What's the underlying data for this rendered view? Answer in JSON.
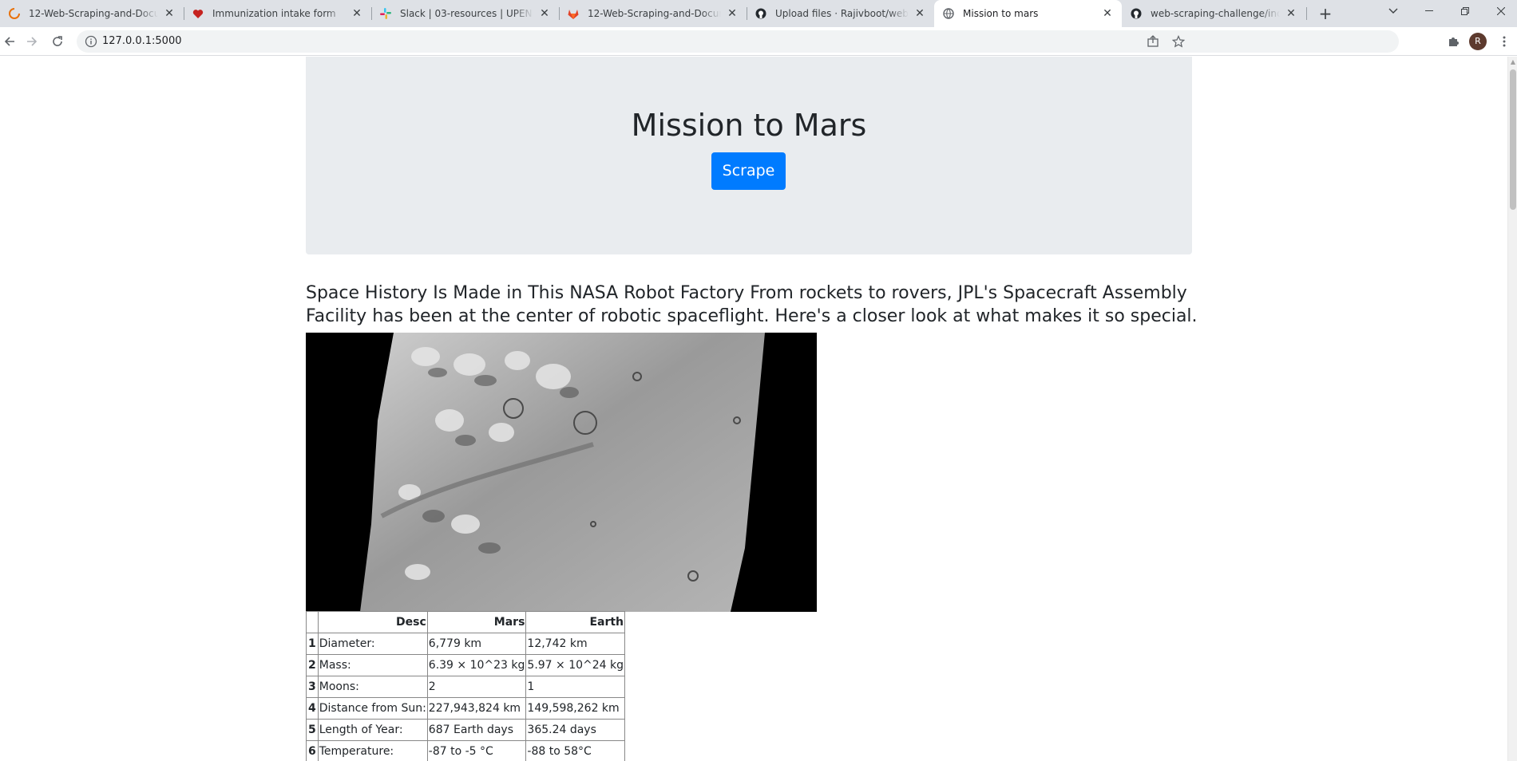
{
  "browser": {
    "tabs": [
      {
        "title": "12-Web-Scraping-and-Document",
        "icon": "loading-spinner-icon",
        "active": false
      },
      {
        "title": "Immunization intake form",
        "icon": "heart-icon",
        "active": false
      },
      {
        "title": "Slack | 03-resources | UPENN-PHL",
        "icon": "slack-icon",
        "active": false
      },
      {
        "title": "12-Web-Scraping-and-Document",
        "icon": "gitlab-icon",
        "active": false
      },
      {
        "title": "Upload files · Rajivboot/web-scra",
        "icon": "github-icon",
        "active": false
      },
      {
        "title": "Mission to mars",
        "icon": "globe-icon",
        "active": true
      },
      {
        "title": "web-scraping-challenge/index.h",
        "icon": "github-icon",
        "active": false
      }
    ],
    "url": "127.0.0.1:5000",
    "profile_initial": "R"
  },
  "page": {
    "title": "Mission to Mars",
    "scrape_button": "Scrape",
    "headline": "Space History Is Made in This NASA Robot Factory From rockets to rovers, JPL's Spacecraft Assembly Facility has been at the center of robotic spaceflight. Here's a closer look at what makes it so special.",
    "featured_image_alt": "mars-surface-image",
    "facts_table": {
      "headers": [
        "",
        "Desc",
        "Mars",
        "Earth"
      ],
      "rows": [
        {
          "index": "1",
          "desc": "Diameter:",
          "mars": "6,779 km",
          "earth": "12,742 km"
        },
        {
          "index": "2",
          "desc": "Mass:",
          "mars": "6.39 × 10^23 kg",
          "earth": "5.97 × 10^24 kg"
        },
        {
          "index": "3",
          "desc": "Moons:",
          "mars": "2",
          "earth": "1"
        },
        {
          "index": "4",
          "desc": "Distance from Sun:",
          "mars": "227,943,824 km",
          "earth": "149,598,262 km"
        },
        {
          "index": "5",
          "desc": "Length of Year:",
          "mars": "687 Earth days",
          "earth": "365.24 days"
        },
        {
          "index": "6",
          "desc": "Temperature:",
          "mars": "-87 to -5 °C",
          "earth": "-88 to 58°C"
        }
      ]
    }
  },
  "colors": {
    "accent": "#007bff",
    "jumbotron_bg": "#e9ecef",
    "tabstrip_bg": "#dee1e6"
  }
}
